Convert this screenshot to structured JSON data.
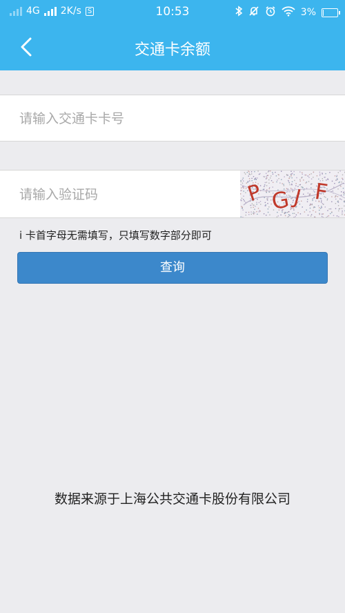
{
  "status_bar": {
    "network": "4G",
    "speed": "2K/s",
    "speed_badge": "S",
    "time": "10:53",
    "battery": "3%",
    "battery_level": 0.03
  },
  "header": {
    "title": "交通卡余额",
    "back_icon": "chevron-left-icon"
  },
  "form": {
    "card_number_placeholder": "请输入交通卡卡号",
    "card_number_value": "",
    "captcha_placeholder": "请输入验证码",
    "captcha_value": "",
    "captcha_text": "PGJF",
    "hint": "i 卡首字母无需填写，只填写数字部分即可",
    "query_label": "查询"
  },
  "footer": {
    "source_text": "数据来源于上海公共交通卡股份有限公司"
  },
  "colors": {
    "header_bg": "#3cb5ee",
    "button_bg": "#3c88cb",
    "page_bg": "#ececef",
    "captcha_letters": "#c0392b"
  }
}
